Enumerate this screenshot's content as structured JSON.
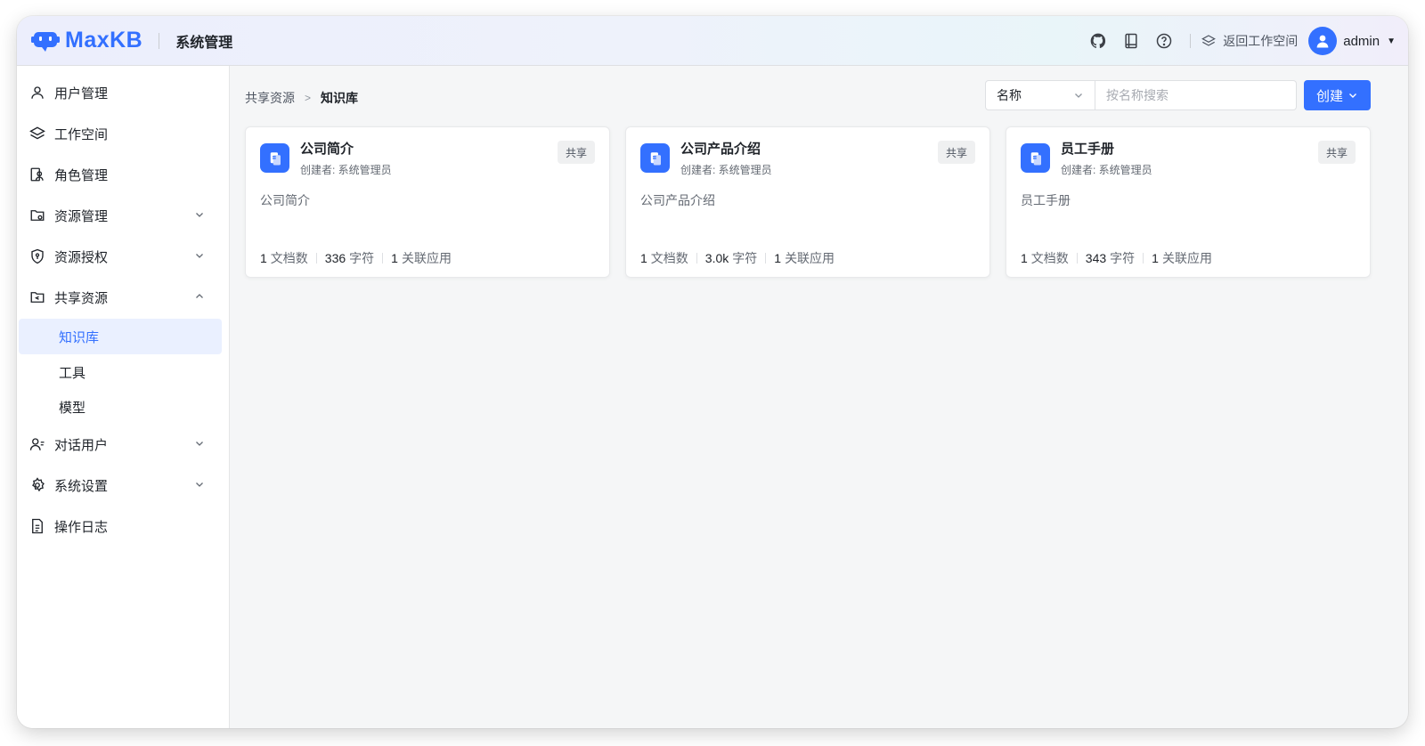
{
  "brand": {
    "name": "MaxKB",
    "section_title": "系统管理",
    "accent": "#3370ff"
  },
  "topbar": {
    "icons": [
      "github-icon",
      "book-icon",
      "help-icon"
    ],
    "back_workspace": "返回工作空间",
    "user": "admin"
  },
  "sidebar": {
    "items": [
      {
        "label": "用户管理",
        "icon": "user-icon"
      },
      {
        "label": "工作空间",
        "icon": "layers-icon"
      },
      {
        "label": "角色管理",
        "icon": "role-icon"
      },
      {
        "label": "资源管理",
        "icon": "folder-gear-icon"
      },
      {
        "label": "资源授权",
        "icon": "shield-icon"
      },
      {
        "label": "共享资源",
        "icon": "folder-share-icon"
      },
      {
        "label": "对话用户",
        "icon": "chat-user-icon"
      },
      {
        "label": "系统设置",
        "icon": "gear-icon"
      },
      {
        "label": "操作日志",
        "icon": "log-icon"
      }
    ],
    "sub_items": [
      {
        "label": "知识库",
        "active": true
      },
      {
        "label": "工具",
        "active": false
      },
      {
        "label": "模型",
        "active": false
      }
    ]
  },
  "breadcrumb": {
    "parent": "共享资源",
    "current": "知识库"
  },
  "search": {
    "field": "名称",
    "placeholder": "按名称搜索"
  },
  "create_label": "创建",
  "cards": [
    {
      "title": "公司简介",
      "creator": "创建者: 系统管理员",
      "badge": "共享",
      "desc": "公司简介",
      "docs": "1",
      "docs_label": "文档数",
      "chars": "336",
      "chars_label": "字符",
      "apps": "1",
      "apps_label": "关联应用"
    },
    {
      "title": "公司产品介绍",
      "creator": "创建者: 系统管理员",
      "badge": "共享",
      "desc": "公司产品介绍",
      "docs": "1",
      "docs_label": "文档数",
      "chars": "3.0k",
      "chars_label": "字符",
      "apps": "1",
      "apps_label": "关联应用"
    },
    {
      "title": "员工手册",
      "creator": "创建者: 系统管理员",
      "badge": "共享",
      "desc": "员工手册",
      "docs": "1",
      "docs_label": "文档数",
      "chars": "343",
      "chars_label": "字符",
      "apps": "1",
      "apps_label": "关联应用"
    }
  ]
}
